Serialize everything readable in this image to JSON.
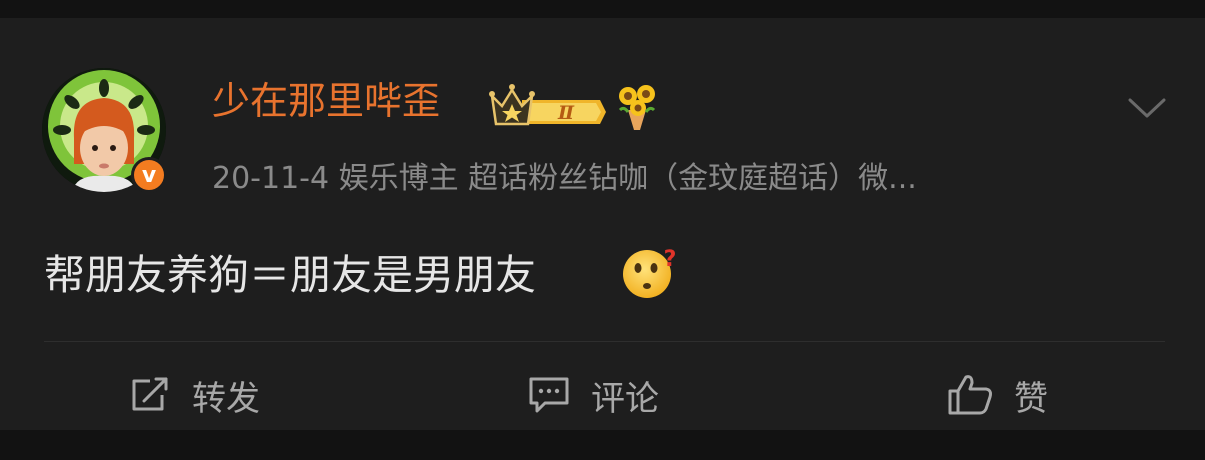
{
  "post": {
    "username": "少在那里哔歪",
    "meta": "20-11-4  娱乐博主 超话粉丝钻咖（金玟庭超话）微...",
    "content": "帮朋友养狗＝朋友是男朋友",
    "verified_badge": "v",
    "level_badge": "Ⅱ"
  },
  "actions": {
    "repost": "转发",
    "comment": "评论",
    "like": "赞"
  },
  "icons": {
    "avatar": "avatar",
    "crown": "crown-level-icon",
    "flower": "sunflower-bouquet-icon",
    "menu": "chevron-down-icon",
    "emoji": "thinking-emoji-icon",
    "repost": "share-icon",
    "comment": "comment-icon",
    "like": "thumbs-up-icon"
  },
  "colors": {
    "background": "#121212",
    "card": "#1e1e1e",
    "username": "#e8732e",
    "meta": "#8a8a8a",
    "content": "#e6e6e6",
    "action": "#a8a8a8",
    "verified": "#f47c20"
  }
}
